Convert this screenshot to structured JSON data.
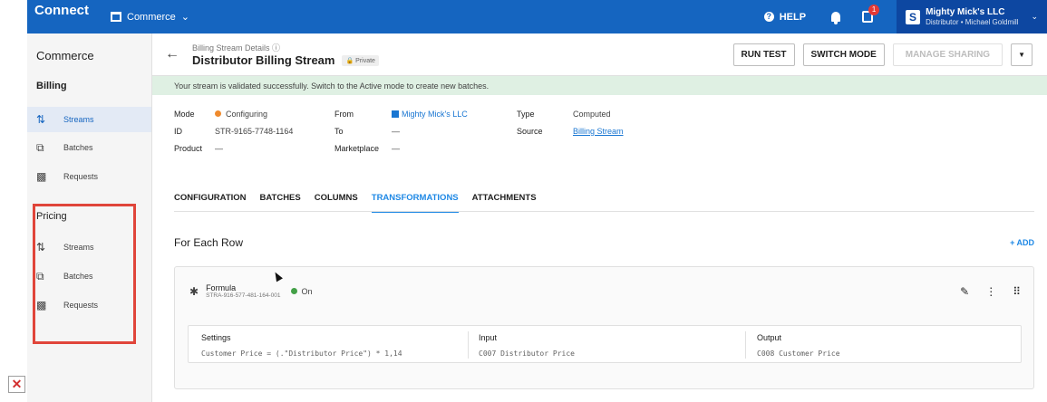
{
  "topbar": {
    "brand": "Connect",
    "app_name": "Commerce",
    "help_label": "HELP",
    "notifications_badge": "1",
    "account_initial": "S",
    "account_name": "Mighty Mick's LLC",
    "account_sub": "Distributor • Michael Goldmill",
    "color": "#1565c0"
  },
  "sidebar": {
    "title": "Commerce",
    "groups": [
      {
        "label": "Billing",
        "items": [
          {
            "label": "Streams",
            "icon": "streams-icon",
            "active": true
          },
          {
            "label": "Batches",
            "icon": "batches-icon"
          },
          {
            "label": "Requests",
            "icon": "requests-icon"
          }
        ]
      },
      {
        "label": "Pricing",
        "items": [
          {
            "label": "Streams",
            "icon": "streams-icon"
          },
          {
            "label": "Batches",
            "icon": "batches-icon"
          },
          {
            "label": "Requests",
            "icon": "requests-icon"
          }
        ]
      }
    ],
    "highlight_color": "#e0453a"
  },
  "header": {
    "breadcrumb": "Billing Stream Details",
    "title": "Distributor Billing Stream",
    "visibility": "Private",
    "buttons": {
      "run_test": "RUN TEST",
      "switch_mode": "SWITCH MODE",
      "manage_sharing": "MANAGE SHARING"
    }
  },
  "banner": {
    "text": "Your stream is validated successfully. Switch to the Active mode to create new batches."
  },
  "details": {
    "mode_label": "Mode",
    "mode_value": "Configuring",
    "id_label": "ID",
    "id_value": "STR-9165-7748-1164",
    "product_label": "Product",
    "product_value": "—",
    "from_label": "From",
    "from_value": "Mighty Mick's LLC",
    "to_label": "To",
    "to_value": "—",
    "marketplace_label": "Marketplace",
    "marketplace_value": "—",
    "type_label": "Type",
    "type_value": "Computed",
    "source_label": "Source",
    "source_value": "Billing Stream"
  },
  "tabs": [
    {
      "label": "CONFIGURATION"
    },
    {
      "label": "BATCHES"
    },
    {
      "label": "COLUMNS"
    },
    {
      "label": "TRANSFORMATIONS",
      "active": true
    },
    {
      "label": "ATTACHMENTS"
    }
  ],
  "section": {
    "title": "For Each Row",
    "add_label": "+ ADD"
  },
  "formula": {
    "name": "Formula",
    "id": "STRA-916-577-481-164-001",
    "status": "On",
    "settings_label": "Settings",
    "settings_value": "Customer Price = (.\"Distributor Price\") * 1,14",
    "input_label": "Input",
    "input_value": "C007  Distributor Price",
    "output_label": "Output",
    "output_value": "C008  Customer Price"
  }
}
